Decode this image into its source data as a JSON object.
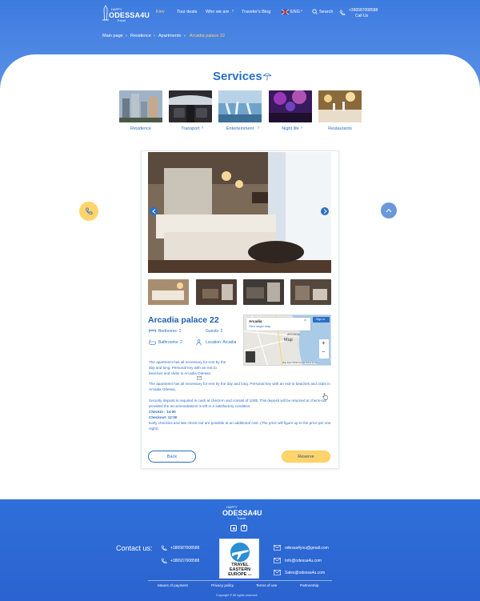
{
  "header": {
    "logo": {
      "small": "HAPPY",
      "name": "ODESSA4U",
      "sub": "Travel"
    },
    "nav": [
      "Kiev",
      "Tour deals",
      "Who we are",
      "Traveler's Blog"
    ],
    "language": "ENG",
    "search": "Search",
    "phone": "+380587008588",
    "call_label": "Call Us"
  },
  "breadcrumb": [
    "Main page",
    "Residence",
    "Apartments",
    "Arcadia palace 22"
  ],
  "services": {
    "title": "Services",
    "items": [
      "Residence",
      "Transport",
      "Enterteinment",
      "Night life",
      "Restaurants"
    ]
  },
  "apartment": {
    "name": "Arcadia palace 22",
    "bedrooms": "Bedrooms: 2",
    "guests": "Guests: 2",
    "bathrooms": "Bathrooms: 2",
    "location": "Location: Arcadia",
    "map": {
      "place": "Arcadia",
      "link": "View larger map",
      "sign_in": "Sign in",
      "label": "Map",
      "footer": "Map data ©2019 Google   Terms of Use",
      "city_label": "ARCADIA"
    },
    "desc1": "The apartment has all necessary for rent by the day and long. Personal key with an exit to beaches and clubs in Arcadia Odessa.",
    "desc2": "The apartment has all necessary for rent by the day and long. Personal key with an exit to beaches and clubs in Arcadia Odessa.",
    "desc3": "Security deposit is required in cash at check-in and consist of 100$. This deposit will be returned at check-out provided the accommodations is left in a satisfactory condition.",
    "checkin": "Checkin : 14:00",
    "checkout": "Checkout: 12:00",
    "desc4": "Early checkins and late check-out are possible at an additional cost. (The price will figure up to the price per one night)",
    "back": "Back",
    "reserve": "Reserve"
  },
  "footer": {
    "logo": {
      "small": "HAPPY",
      "name": "ODESSA4U",
      "sub": "Travel"
    },
    "contact_label": "Contact us:",
    "phones": [
      "+380587008588",
      "+380937008588"
    ],
    "emails": [
      "odessa4you@gmail.com",
      "Info@odessa4u.com",
      "Sales@odessa4u.com"
    ],
    "badge": {
      "line1": "TRAVEL",
      "line2": "EASTERN",
      "line3": "EUROPE",
      "suffix": "com"
    },
    "links": [
      "Means of payment",
      "Privacy policy",
      "Terms of use",
      "Partnership"
    ],
    "copyright": "Copyright © All rights reserved."
  },
  "colors": {
    "primary": "#2a6fc7",
    "accent": "#ffd46b",
    "footer": "#2b63cf"
  }
}
